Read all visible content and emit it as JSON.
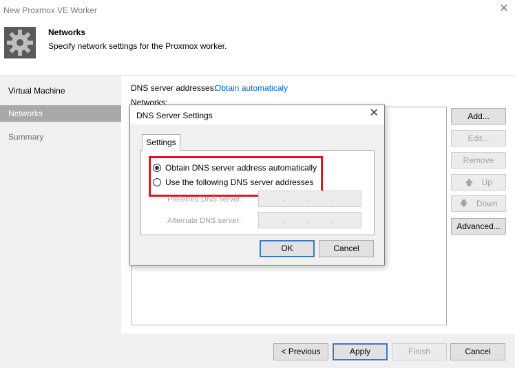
{
  "window": {
    "title": "New Proxmox VE Worker",
    "close_glyph": "✕"
  },
  "header": {
    "icon": "gear-icon",
    "title": "Networks",
    "subtitle": "Specify network settings for the Proxmox worker."
  },
  "sidebar": {
    "steps": [
      {
        "label": "Virtual Machine",
        "state": "completed"
      },
      {
        "label": "Networks",
        "state": "active"
      },
      {
        "label": "Summary",
        "state": "upcoming"
      }
    ]
  },
  "main": {
    "dns_label": "DNS server addresses:",
    "dns_link": "Obtain automaticaly",
    "networks_label": "Networks:",
    "side_buttons": {
      "add": "Add...",
      "edit": "Edit...",
      "remove": "Remove",
      "up": "Up",
      "down": "Down",
      "advanced": "Advanced..."
    }
  },
  "footer": {
    "previous": "< Previous",
    "apply": "Apply",
    "finish": "Finish",
    "cancel": "Cancel"
  },
  "dialog": {
    "title": "DNS Server Settings",
    "close_glyph": "✕",
    "tab_label": "Settings",
    "radio_auto": "Obtain DNS server address automatically",
    "radio_manual": "Use the following DNS server addresses",
    "selected": "auto",
    "preferred_label": "Preferred DNS server:",
    "alternate_label": "Alternate DNS server:",
    "ok": "OK",
    "cancel": "Cancel"
  },
  "colors": {
    "link": "#0066cc",
    "highlight": "#e0141d",
    "active_step": "#a9a9a9",
    "primary_border": "#3b78c3"
  }
}
